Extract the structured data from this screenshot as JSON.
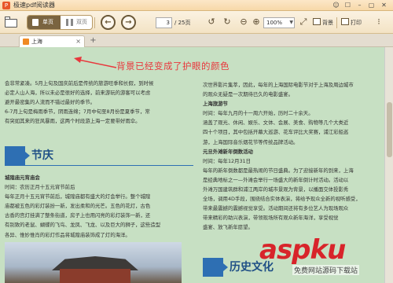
{
  "window": {
    "title": "极速pdf阅读器",
    "app_icon": "pdf-app-icon",
    "controls": [
      "☺",
      "☐",
      "–",
      "▢",
      "✕"
    ]
  },
  "toolbar": {
    "single_page_label": "单页",
    "double_page_label": "双页",
    "page_current": "3",
    "page_total": "/ 25页",
    "zoom_value": "100%",
    "background_label": "背景",
    "print_label": "打印",
    "prev_glyph": "←",
    "next_glyph": "→"
  },
  "tabs": {
    "doc_tab_label": "上海",
    "close_glyph": "×",
    "new_tab_glyph": "+"
  },
  "annotation": "背景已经变成了护眼的颜色",
  "document": {
    "left_lines": [
      "会非常紧凑。5月上旬及国庆前后是传统的旅游旺季和长假，到时候",
      "必定人山人海，所以未必是很好的选择，前来游玩的游客可以考虑",
      "避开最密集的人流而不错过最好的季节。",
      "6-7月上旬是梅雨季节，阴雨连绵；7月中旬至8月份是夏季节，常",
      "有突如其来的狂风暴雨，这两个时段游上海一定要带好雨伞。"
    ],
    "section1_title": "节庆",
    "left_lines2": [
      {
        "text": "城隍庙元宵庙会",
        "bold": true
      },
      {
        "text": "时间：农历正月十五元宵节前后",
        "bold": false
      },
      {
        "text": "每年正月十五元宵节前后，城隍庙都有盛大的灯会举行。整个城隍",
        "bold": false
      },
      {
        "text": "庙都被五色的彩灯装扮一新，发出柔和的光芒。五色的花灯，古色",
        "bold": false
      },
      {
        "text": "古香的宫灯挂满了整条街道，房子上也用闪亮的彩灯装饰一新，还",
        "bold": false
      },
      {
        "text": "有别致的老鼠、蝴蝶的飞鸟、龙凤、飞龙、以及巨大的狮子，这些造型",
        "bold": false
      },
      {
        "text": "各异、惟妙惟肖的彩灯作品将城隍庙装饰成了灯的海洋。",
        "bold": false
      }
    ],
    "right_lines": [
      {
        "text": "次世界影片集萃，因此，每年的上海国际电影节对于上海及周边城市",
        "bold": false
      },
      {
        "text": "的观众无疑是一次期待已久的电影盛宴。",
        "bold": false
      },
      {
        "text": "上海旅游节",
        "bold": true
      },
      {
        "text": "时间：每年九月的十一周六开始，历时二十余天。",
        "bold": false
      },
      {
        "text": "涵盖了观光、休闲、娱乐、文体、会展、美食、购物等几个大类近",
        "bold": false
      },
      {
        "text": "四十个项目，其中包括开幕大巡游、花车评比大奖赛，浦江彩船巡",
        "bold": false
      },
      {
        "text": "游，上海国际音乐烟花节等传统品牌活动。",
        "bold": false
      },
      {
        "text": "元旦外滩新年倒数活动",
        "bold": true
      },
      {
        "text": "时间：每年12月31日",
        "bold": false
      },
      {
        "text": "每年的新年倒数都是最热闹的节日盛典。为了迎接新年的到来，上海",
        "bold": false
      },
      {
        "text": "是经典地标之一—外滩会举行一场盛大的新年倒计时活动。活动以",
        "bold": false
      },
      {
        "text": "外滩万国建筑群和浦江两岸的城市景观为背景，以播面交体投影秀",
        "bold": false
      },
      {
        "text": "全场，调用4D手段，围绕结合实体表演，将给予现众全新的视听感受，",
        "bold": false
      },
      {
        "text": "带来最震撼的震撼视觉享受。活动期间还将有多位艺人为现场观众",
        "bold": false
      },
      {
        "text": "带来精彩的助兴表演，带领现场所有观众新年海洋，享受视觉",
        "bold": false
      },
      {
        "text": "盛宴、放飞新年愿望。",
        "bold": false
      }
    ],
    "section2_title": "历史文化"
  },
  "watermark": {
    "text": "aspku",
    "sub": "免费网站源码下载站",
    "color": "#d8242a"
  },
  "colors": {
    "reading_background": "#c7e0c3",
    "annotation": "#e8383d",
    "section_blue": "#2e6fb3"
  }
}
